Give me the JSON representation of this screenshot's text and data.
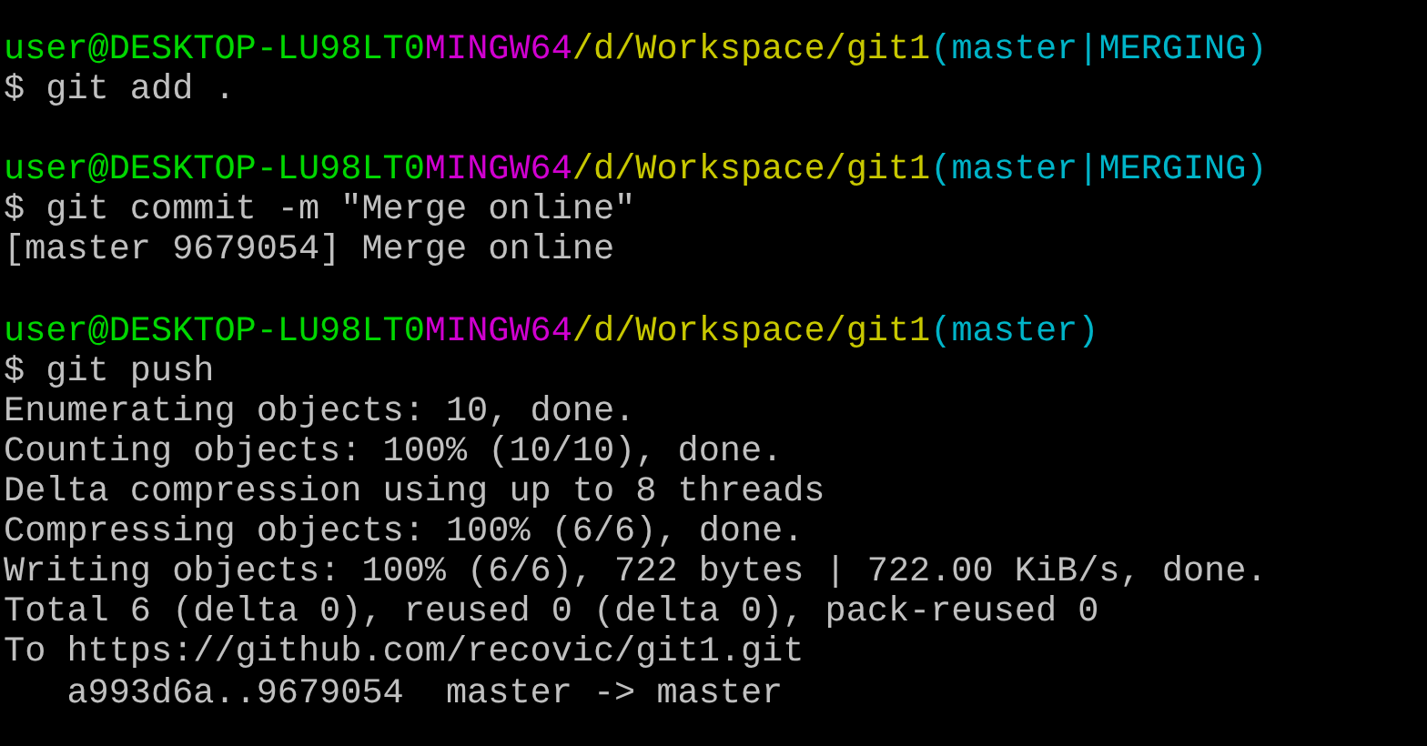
{
  "terminal": {
    "lines": [
      {
        "kind": "prompt",
        "user": "user@DESKTOP-LU98LT0",
        "system": "MINGW64",
        "path": "/d/Workspace/git1",
        "branch": "(master|MERGING)"
      },
      {
        "kind": "command",
        "text": "$ git add ."
      },
      {
        "kind": "blank"
      },
      {
        "kind": "prompt",
        "user": "user@DESKTOP-LU98LT0",
        "system": "MINGW64",
        "path": "/d/Workspace/git1",
        "branch": "(master|MERGING)"
      },
      {
        "kind": "command",
        "text": "$ git commit -m \"Merge online\""
      },
      {
        "kind": "output",
        "text": "[master 9679054] Merge online"
      },
      {
        "kind": "blank"
      },
      {
        "kind": "prompt",
        "user": "user@DESKTOP-LU98LT0",
        "system": "MINGW64",
        "path": "/d/Workspace/git1",
        "branch": "(master)"
      },
      {
        "kind": "command",
        "text": "$ git push"
      },
      {
        "kind": "output",
        "text": "Enumerating objects: 10, done."
      },
      {
        "kind": "output",
        "text": "Counting objects: 100% (10/10), done."
      },
      {
        "kind": "output",
        "text": "Delta compression using up to 8 threads"
      },
      {
        "kind": "output",
        "text": "Compressing objects: 100% (6/6), done."
      },
      {
        "kind": "output",
        "text": "Writing objects: 100% (6/6), 722 bytes | 722.00 KiB/s, done."
      },
      {
        "kind": "output",
        "text": "Total 6 (delta 0), reused 0 (delta 0), pack-reused 0"
      },
      {
        "kind": "output",
        "text": "To https://github.com/recovic/git1.git"
      },
      {
        "kind": "output",
        "text": "   a993d6a..9679054  master -> master"
      }
    ]
  }
}
